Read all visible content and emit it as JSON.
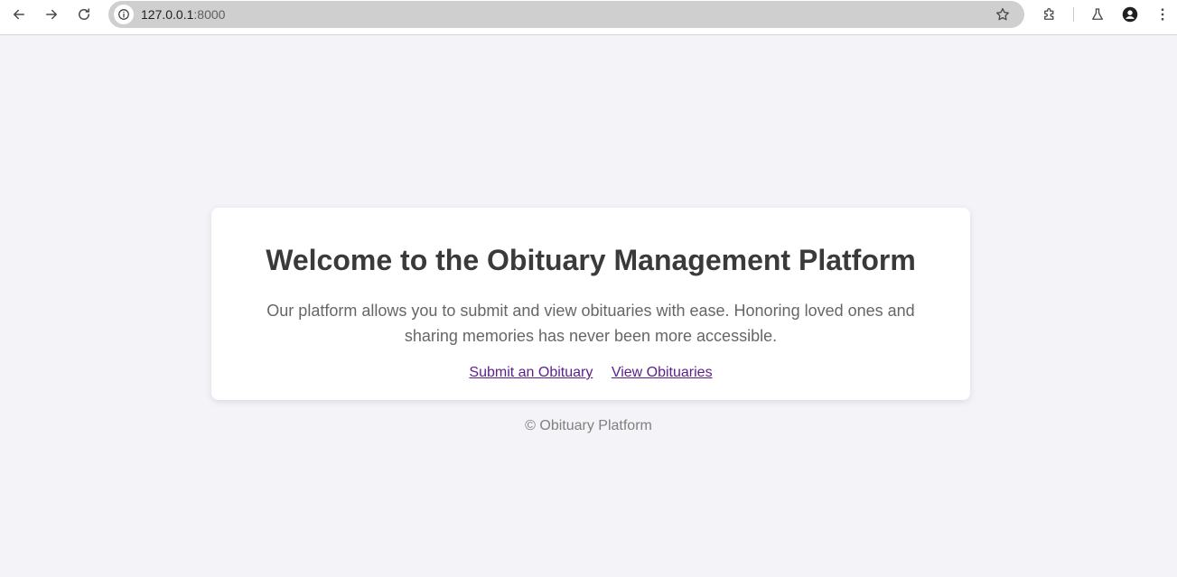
{
  "browser": {
    "url_host": "127.0.0.1",
    "url_port": ":8000",
    "icons": {
      "back": "arrow-left-icon",
      "forward": "arrow-right-icon",
      "reload": "reload-icon",
      "site_info": "info-icon",
      "bookmark": "star-icon",
      "extensions": "puzzle-icon",
      "labs": "flask-icon",
      "profile": "profile-avatar-icon",
      "menu": "kebab-menu-icon"
    }
  },
  "main": {
    "title": "Welcome to the Obituary Management Platform",
    "description": "Our platform allows you to submit and view obituaries with ease. Honoring loved ones and sharing memories has never been more accessible.",
    "links": {
      "submit": "Submit an Obituary",
      "view": "View Obituaries"
    }
  },
  "footer": {
    "text": "© Obituary Platform"
  },
  "colors": {
    "page_bg": "#f4f4f8",
    "card_bg": "#ffffff",
    "title": "#3a3a3a",
    "text": "#666666",
    "link": "#5b1f8a",
    "footer": "#808080"
  }
}
